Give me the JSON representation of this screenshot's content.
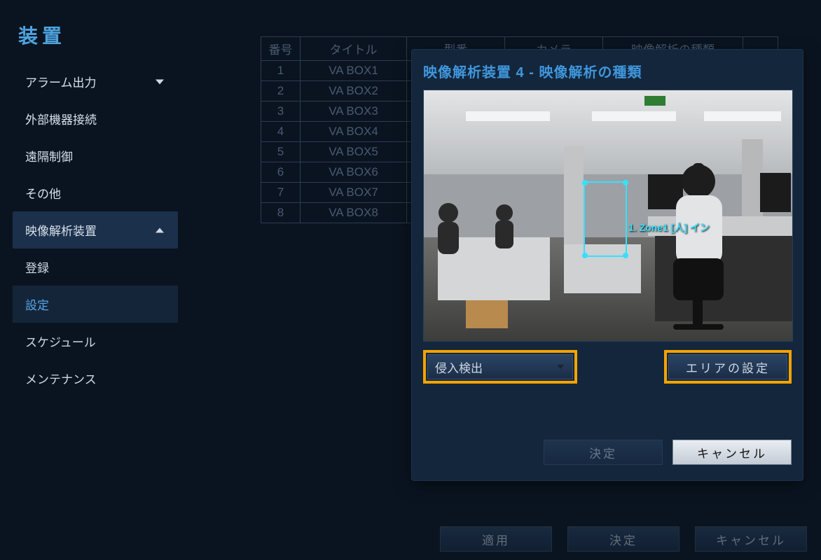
{
  "sidebar": {
    "title": "装置",
    "items": [
      {
        "label": "アラーム出力",
        "kind": "expandable"
      },
      {
        "label": "外部機器接続",
        "kind": "plain"
      },
      {
        "label": "遠隔制御",
        "kind": "plain"
      },
      {
        "label": "その他",
        "kind": "plain"
      },
      {
        "label": "映像解析装置",
        "kind": "expanded",
        "active": true,
        "children": [
          {
            "label": "登録"
          },
          {
            "label": "設定",
            "selected": true
          },
          {
            "label": "スケジュール"
          },
          {
            "label": "メンテナンス"
          }
        ]
      }
    ]
  },
  "bg_table": {
    "headers": [
      "番号",
      "タイトル",
      "型番",
      "カメラ",
      "映像解析の種類",
      ""
    ],
    "rows": [
      {
        "idx": "1",
        "title": "VA BOX1"
      },
      {
        "idx": "2",
        "title": "VA BOX2"
      },
      {
        "idx": "3",
        "title": "VA BOX3"
      },
      {
        "idx": "4",
        "title": "VA BOX4"
      },
      {
        "idx": "5",
        "title": "VA BOX5"
      },
      {
        "idx": "6",
        "title": "VA BOX6"
      },
      {
        "idx": "7",
        "title": "VA BOX7"
      },
      {
        "idx": "8",
        "title": "VA BOX8"
      }
    ]
  },
  "modal": {
    "title": "映像解析装置 4 - 映像解析の種類",
    "zone_label": "1. Zone1 [人] イン",
    "dropdown_value": "侵入検出",
    "area_button": "エリアの設定",
    "ok_label": "決定",
    "cancel_label": "キャンセル"
  },
  "bottom": {
    "apply_label": "適用",
    "ok_label": "決定",
    "cancel_label": "キャンセル"
  }
}
